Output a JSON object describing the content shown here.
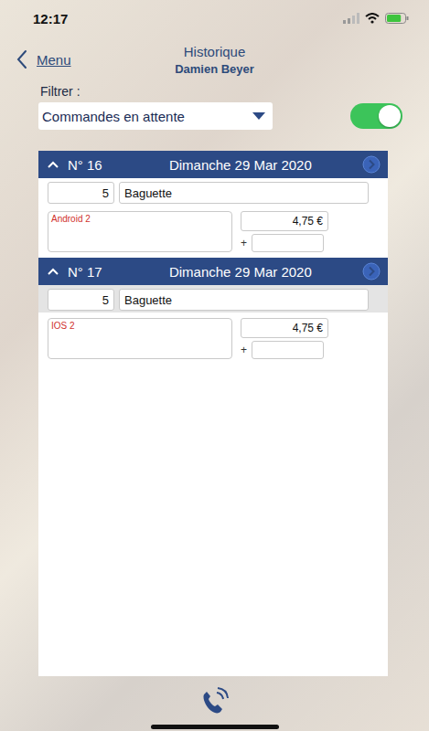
{
  "status_bar": {
    "time": "12:17",
    "battery_level": 0.8
  },
  "header": {
    "back": "Menu",
    "title": "Historique",
    "subtitle": "Damien Beyer"
  },
  "filter": {
    "label": "Filtrer :",
    "value": "Commandes en attente",
    "toggle_on": true
  },
  "orders": [
    {
      "number": "N° 16",
      "date": "Dimanche 29 Mar 2020",
      "expanded": true,
      "items": [
        {
          "quantity": "5",
          "product": "Baguette",
          "selected": false
        }
      ],
      "comment": "Android 2",
      "price": "4,75 €",
      "plus": "+",
      "extra": ""
    },
    {
      "number": "N° 17",
      "date": "Dimanche 29 Mar 2020",
      "expanded": true,
      "items": [
        {
          "quantity": "5",
          "product": "Baguette",
          "selected": true
        }
      ],
      "comment": "IOS 2",
      "price": "4,75 €",
      "plus": "+",
      "extra": ""
    }
  ]
}
